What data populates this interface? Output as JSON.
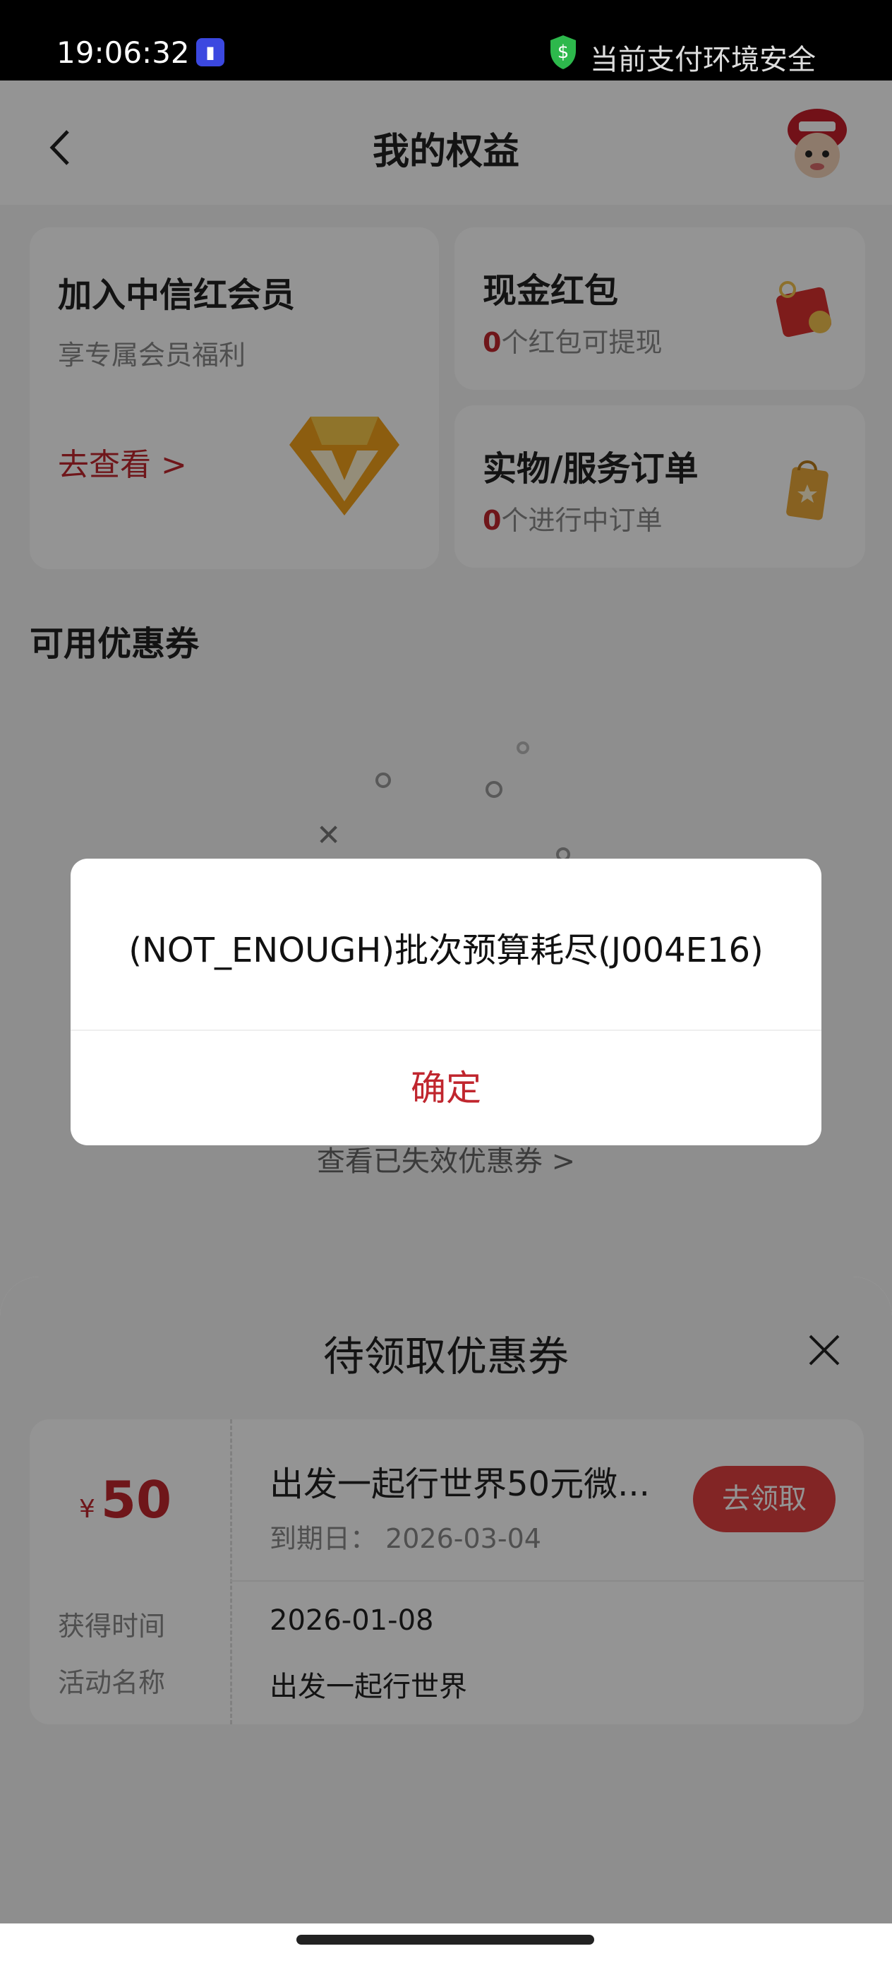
{
  "status_bar": {
    "time": "19:06:32",
    "secure_text": "当前支付环境安全"
  },
  "header": {
    "title": "我的权益"
  },
  "member_card": {
    "title": "加入中信红会员",
    "subtitle": "享专属会员福利",
    "link": "去查看 >"
  },
  "cash_card": {
    "title": "现金红包",
    "count": "0",
    "subtitle": "个红包可提现"
  },
  "order_card": {
    "title": "实物/服务订单",
    "count": "0",
    "subtitle": "个进行中订单"
  },
  "coupons_section": {
    "title": "可用优惠券",
    "expired_link": "查看已失效优惠券 >"
  },
  "sheet": {
    "title": "待领取优惠券",
    "coupon": {
      "currency": "¥",
      "amount": "50",
      "name": "出发一起行世界50元微...",
      "expiry": "到期日：  2026-03-04",
      "claim_label": "去领取",
      "obtained_label": "获得时间",
      "obtained_value": "2026-01-08",
      "activity_label": "活动名称",
      "activity_value": "出发一起行世界"
    }
  },
  "dialog": {
    "message": "(NOT_ENOUGH)批次预算耗尽(J004E16)",
    "confirm_label": "确定"
  },
  "colors": {
    "accent_red": "#c0262e",
    "claim_button": "#e04040"
  }
}
